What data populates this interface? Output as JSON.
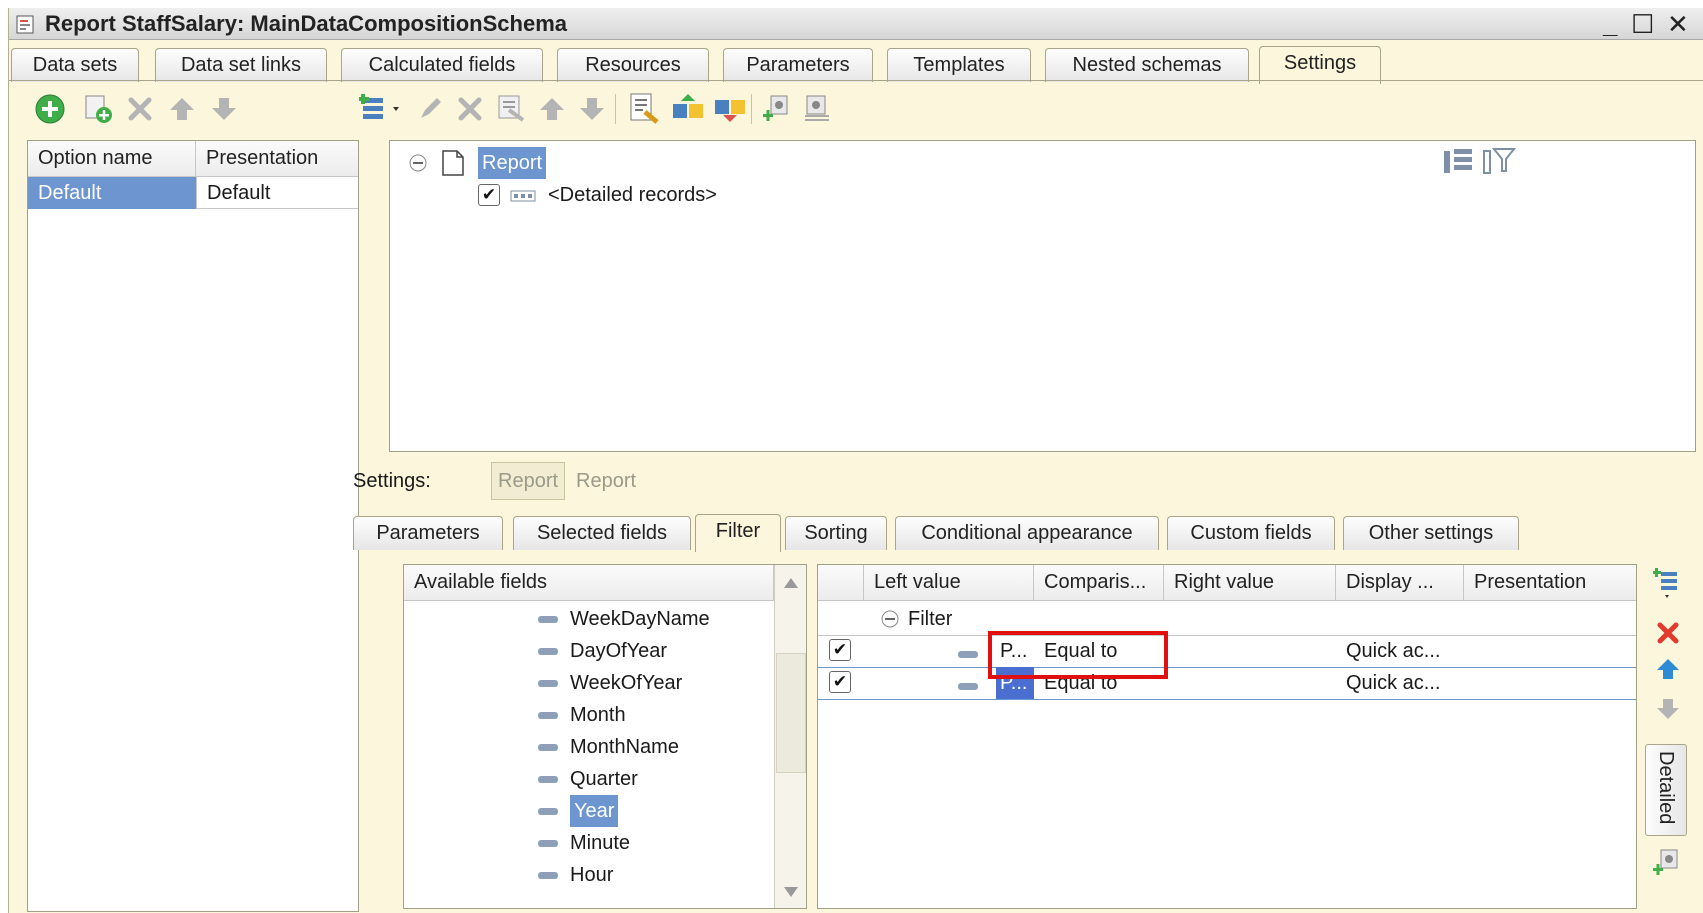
{
  "window": {
    "title": "Report StaffSalary: MainDataCompositionSchema",
    "minimize_glyph": "_",
    "maximize_glyph": "☐",
    "close_glyph": "✕"
  },
  "top_tabs": [
    {
      "label": "Data sets"
    },
    {
      "label": "Data set links"
    },
    {
      "label": "Calculated fields"
    },
    {
      "label": "Resources"
    },
    {
      "label": "Parameters"
    },
    {
      "label": "Templates"
    },
    {
      "label": "Nested schemas"
    },
    {
      "label": "Settings",
      "active": true
    }
  ],
  "options_table": {
    "headers": [
      "Option name",
      "Presentation"
    ],
    "rows": [
      {
        "name": "Default",
        "presentation": "Default"
      }
    ]
  },
  "structure_tree": {
    "root": "Report",
    "child": "<Detailed records>"
  },
  "settings_bar": {
    "label": "Settings:",
    "button": "Report",
    "value": "Report"
  },
  "bottom_tabs": [
    {
      "label": "Parameters"
    },
    {
      "label": "Selected fields"
    },
    {
      "label": "Filter",
      "active": true
    },
    {
      "label": "Sorting"
    },
    {
      "label": "Conditional appearance"
    },
    {
      "label": "Custom fields"
    },
    {
      "label": "Other settings"
    }
  ],
  "available_fields": {
    "header": "Available fields",
    "items": [
      "WeekDayName",
      "DayOfYear",
      "WeekOfYear",
      "Month",
      "MonthName",
      "Quarter",
      "Year",
      "Minute",
      "Hour"
    ],
    "selected": "Year"
  },
  "filter_table": {
    "headers": [
      "Left value",
      "Comparis...",
      "Right value",
      "Display ...",
      "Presentation"
    ],
    "group": "Filter",
    "rows": [
      {
        "left": "P...",
        "comparison": "Equal to",
        "right": "",
        "display": "Quick ac...",
        "presentation": ""
      },
      {
        "left": "P...",
        "comparison": "Equal to",
        "right": "",
        "display": "Quick ac...",
        "presentation": ""
      }
    ]
  },
  "side_buttons": {
    "detailed_label": "Detailed"
  },
  "colors": {
    "window_bg": "#fbf6dc",
    "selection": "#6d95cf",
    "highlight_box": "#e01010"
  }
}
